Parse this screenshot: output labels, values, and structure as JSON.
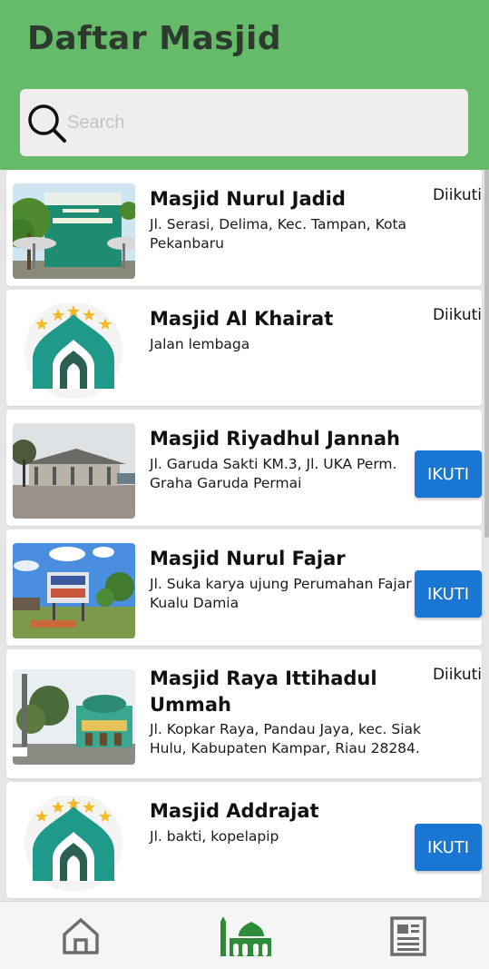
{
  "app": {
    "title": "Daftar Masjid"
  },
  "search": {
    "placeholder": "Search",
    "value": ""
  },
  "masjid_list": [
    {
      "name": "Masjid Nurul Jadid",
      "address": "Jl. Serasi, Delima, Kec. Tampan, Kota Pekanbaru",
      "status": "Diikuti",
      "button": ""
    },
    {
      "name": "Masjid Al Khairat",
      "address": "Jalan lembaga",
      "status": "Diikuti",
      "button": ""
    },
    {
      "name": "Masjid Riyadhul Jannah",
      "address": "Jl. Garuda Sakti KM.3, Jl. UKA Perm. Graha Garuda Permai",
      "status": "",
      "button": "IKUTI"
    },
    {
      "name": "Masjid Nurul Fajar",
      "address": "Jl. Suka karya ujung Perumahan Fajar Kualu Damia",
      "status": "",
      "button": "IKUTI"
    },
    {
      "name": "Masjid Raya Ittihadul Ummah",
      "address": "Jl. Kopkar Raya, Pandau Jaya, kec. Siak Hulu, Kabupaten Kampar, Riau 28284.",
      "status": "Diikuti",
      "button": ""
    },
    {
      "name": "Masjid Addrajat",
      "address": "Jl. bakti, kopelapip",
      "status": "",
      "button": "IKUTI"
    }
  ],
  "colors": {
    "header": "#66bb6a",
    "button": "#1976d2",
    "active_nav": "#2e8b3a",
    "inactive_nav": "#6d6d6d"
  },
  "bottom_nav": [
    {
      "icon": "home-icon",
      "active": false
    },
    {
      "icon": "mosque-icon",
      "active": true
    },
    {
      "icon": "news-icon",
      "active": false
    }
  ]
}
